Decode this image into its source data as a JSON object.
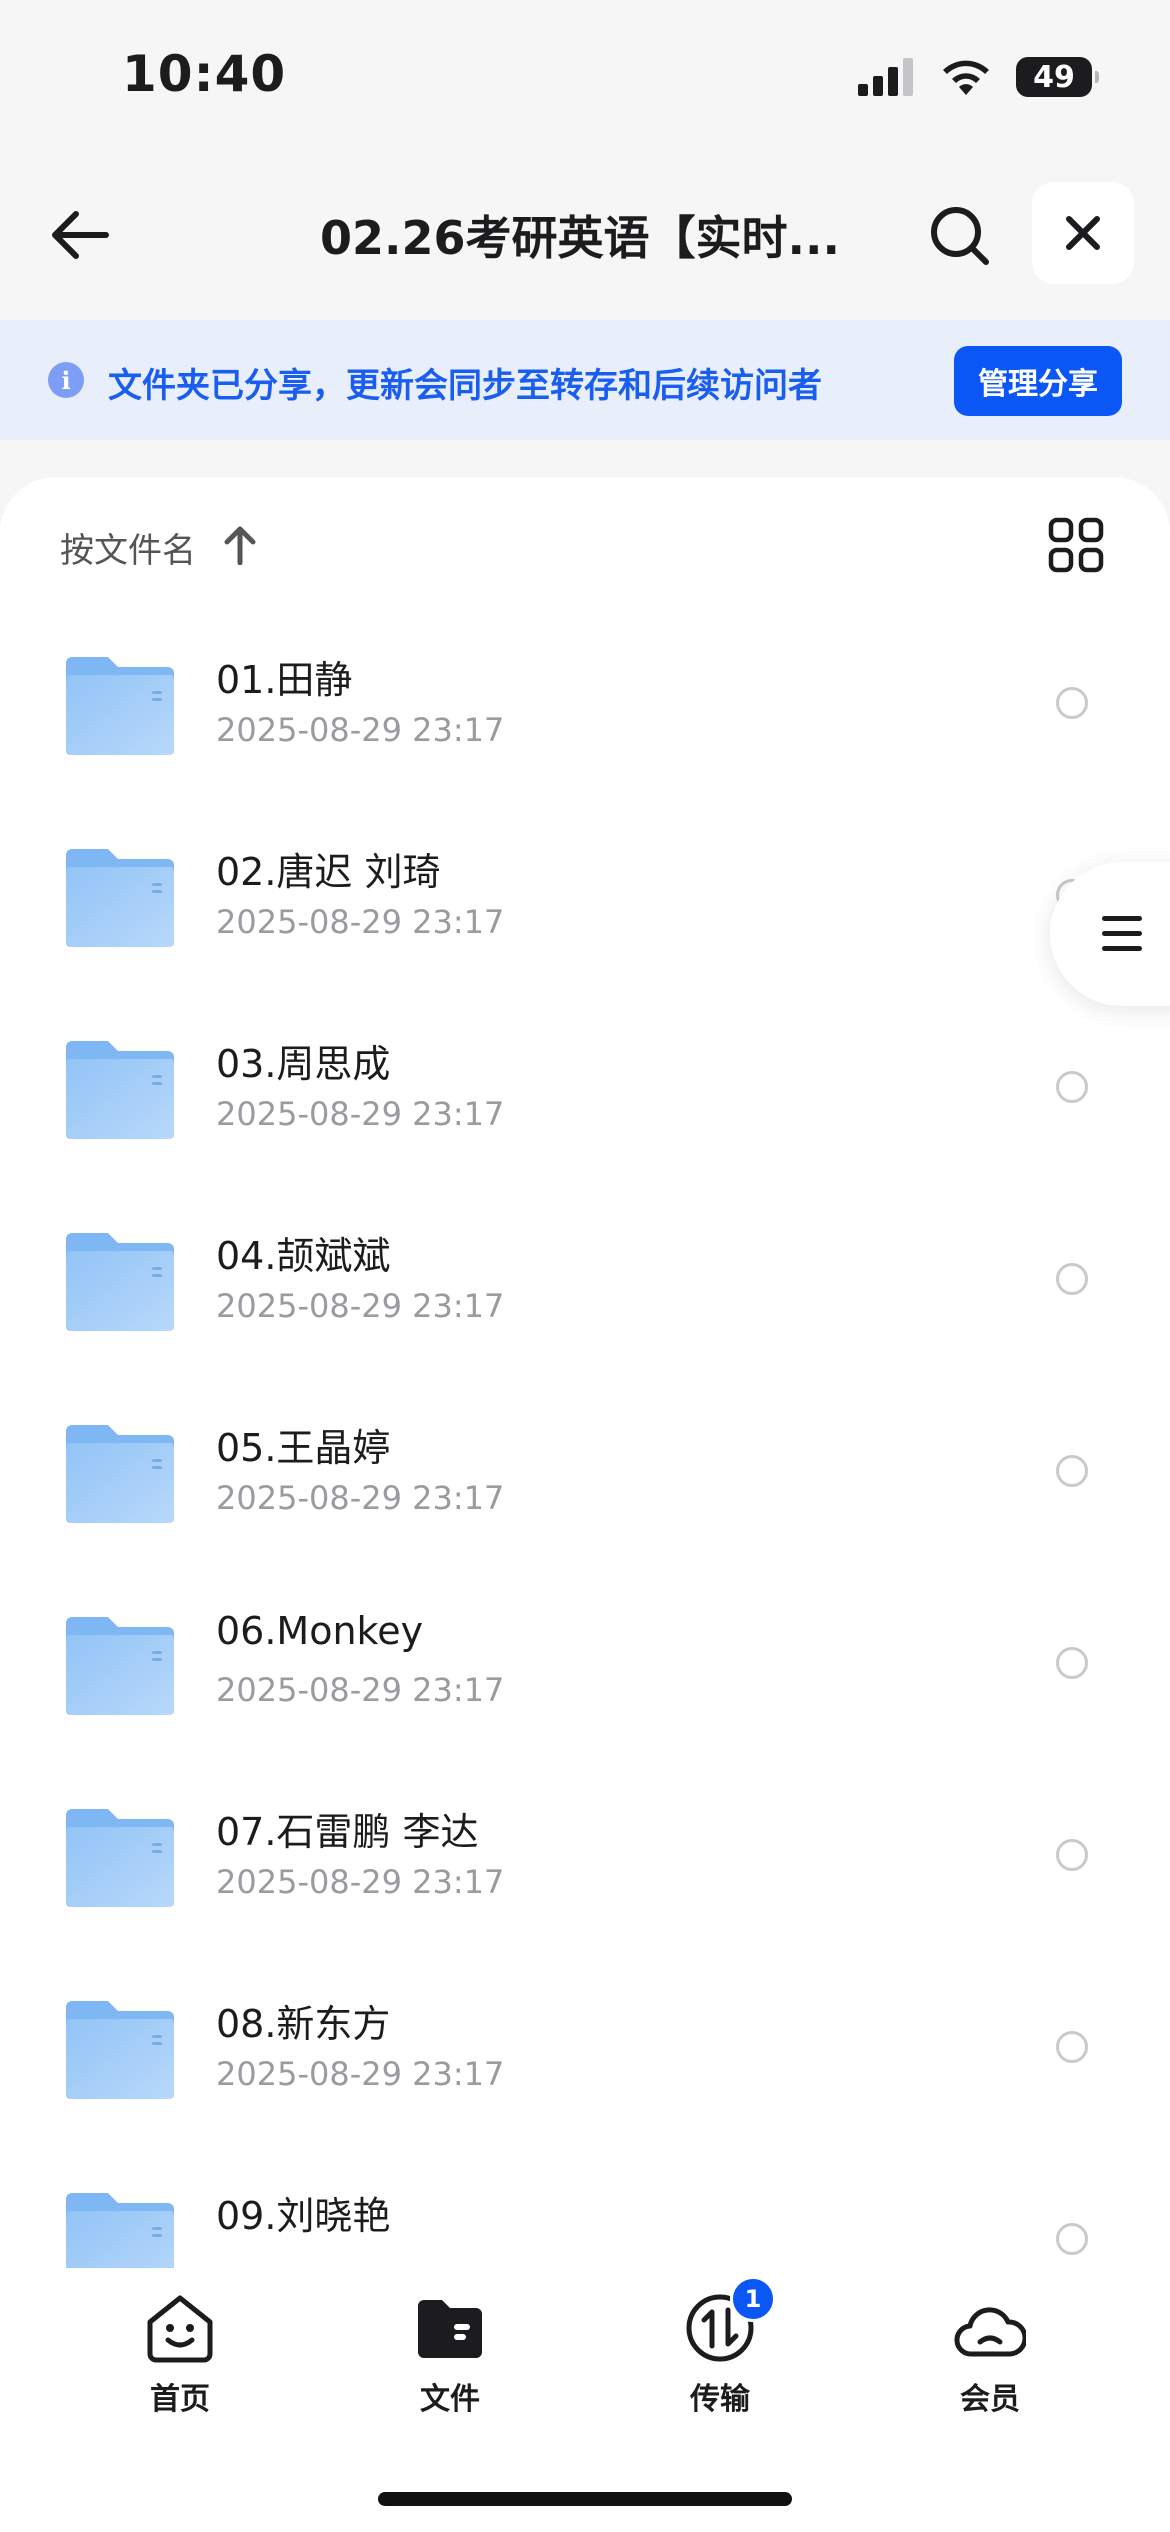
{
  "status_bar": {
    "time": "10:40",
    "battery": "49",
    "icons": [
      "cellular-signal-icon",
      "wifi-icon",
      "battery-icon"
    ]
  },
  "nav": {
    "title": "02.26考研英语【实时...",
    "icons": [
      "back-arrow-icon",
      "search-icon",
      "close-icon"
    ]
  },
  "share_banner": {
    "text": "文件夹已分享，更新会同步至转存和后续访问者",
    "button": "管理分享",
    "icon": "info-icon"
  },
  "sort": {
    "label": "按文件名",
    "direction_icon": "arrow-up-icon",
    "view_icon": "grid-view-icon"
  },
  "files": [
    {
      "name": "01.田静",
      "date": "2025-08-29 23:17"
    },
    {
      "name": "02.唐迟 刘琦",
      "date": "2025-08-29 23:17"
    },
    {
      "name": "03.周思成",
      "date": "2025-08-29 23:17"
    },
    {
      "name": "04.颉斌斌",
      "date": "2025-08-29 23:17"
    },
    {
      "name": "05.王晶婷",
      "date": "2025-08-29 23:17"
    },
    {
      "name": "06.Monkey",
      "date": "2025-08-29 23:17"
    },
    {
      "name": "07.石雷鹏 李达",
      "date": "2025-08-29 23:17"
    },
    {
      "name": "08.新东方",
      "date": "2025-08-29 23:17"
    },
    {
      "name": "09.刘晓艳",
      "date": ""
    }
  ],
  "tabs": [
    {
      "label": "首页",
      "icon": "home-smile-icon"
    },
    {
      "label": "文件",
      "icon": "folder-icon"
    },
    {
      "label": "传输",
      "icon": "transfer-icon",
      "badge": "1"
    },
    {
      "label": "会员",
      "icon": "cloud-icon"
    }
  ],
  "colors": {
    "accent": "#0b57f5",
    "banner_bg": "#e9eefb",
    "banner_text": "#1a5ef0",
    "folder": "#7fb6f4"
  }
}
